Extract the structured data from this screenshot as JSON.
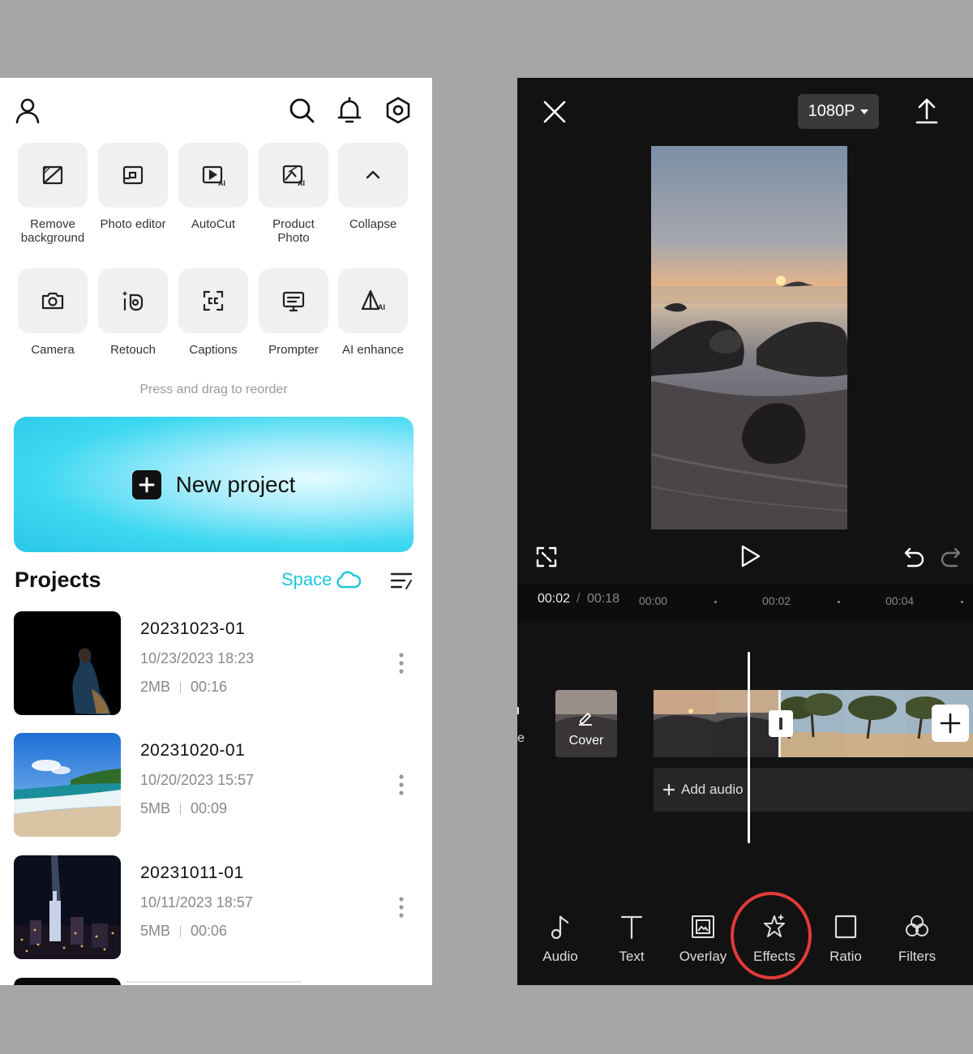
{
  "home": {
    "tools_row1": [
      {
        "label": "Remove\nbackground",
        "icon": "remove-background-icon"
      },
      {
        "label": "Photo editor",
        "icon": "photo-editor-icon"
      },
      {
        "label": "AutoCut",
        "icon": "autocut-icon"
      },
      {
        "label": "Product\nPhoto",
        "icon": "product-photo-icon"
      },
      {
        "label": "Collapse",
        "icon": "chevron-up-icon"
      }
    ],
    "tools_row2": [
      {
        "label": "Camera",
        "icon": "camera-icon"
      },
      {
        "label": "Retouch",
        "icon": "retouch-icon"
      },
      {
        "label": "Captions",
        "icon": "captions-icon"
      },
      {
        "label": "Prompter",
        "icon": "prompter-icon"
      },
      {
        "label": "AI enhance",
        "icon": "ai-enhance-icon"
      }
    ],
    "hint": "Press and drag to reorder",
    "new_project_label": "New project",
    "projects_title": "Projects",
    "space_label": "Space",
    "accent_color": "#1ec6dc",
    "projects": [
      {
        "name": "20231023-01",
        "date": "10/23/2023 18:23",
        "size": "2MB",
        "duration": "00:16"
      },
      {
        "name": "20231020-01",
        "date": "10/20/2023 15:57",
        "size": "5MB",
        "duration": "00:09"
      },
      {
        "name": "20231011-01",
        "date": "10/11/2023 18:57",
        "size": "5MB",
        "duration": "00:06"
      }
    ]
  },
  "editor": {
    "resolution": "1080P",
    "time_current": "00:02",
    "time_separator": "/",
    "time_total": "00:18",
    "ruler_ticks": [
      "00:00",
      "00:02",
      "00:04"
    ],
    "edge_text": "e",
    "cover_label": "Cover",
    "add_audio_label": "Add audio",
    "highlight_color": "#e33a3a",
    "toolbar": [
      {
        "label": "Audio",
        "icon": "music-note-icon"
      },
      {
        "label": "Text",
        "icon": "text-icon"
      },
      {
        "label": "Overlay",
        "icon": "overlay-icon"
      },
      {
        "label": "Effects",
        "icon": "effects-star-icon"
      },
      {
        "label": "Ratio",
        "icon": "ratio-icon"
      },
      {
        "label": "Filters",
        "icon": "filters-icon"
      }
    ]
  }
}
